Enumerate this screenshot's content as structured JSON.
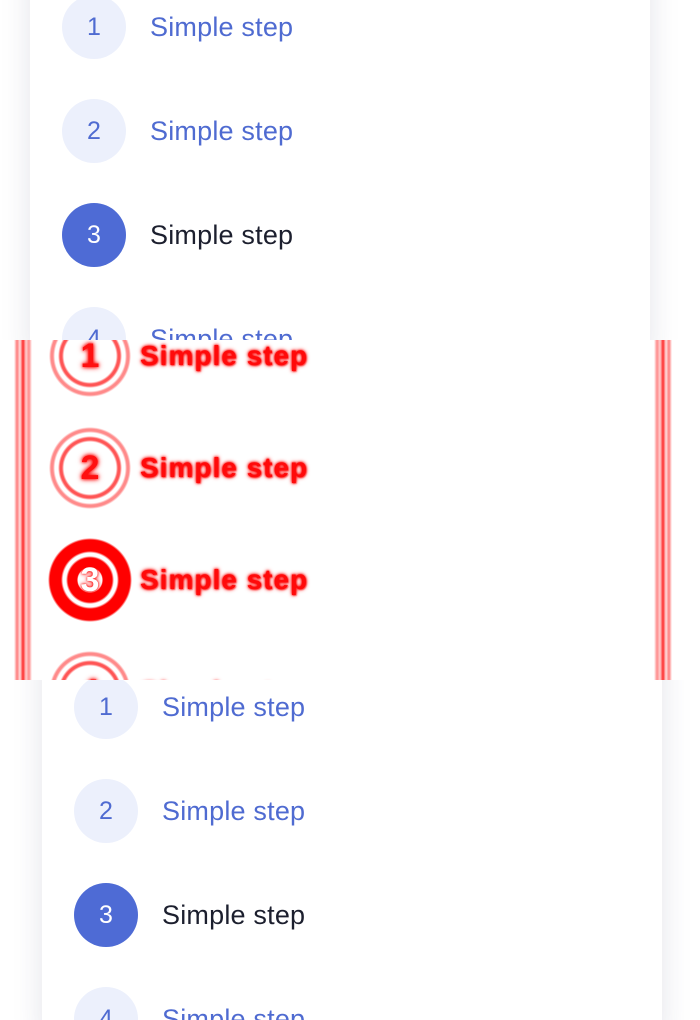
{
  "steps": [
    {
      "number": "1",
      "label": "Simple step",
      "state": "upcoming"
    },
    {
      "number": "2",
      "label": "Simple step",
      "state": "upcoming"
    },
    {
      "number": "3",
      "label": "Simple step",
      "state": "active"
    },
    {
      "number": "4",
      "label": "Simple step",
      "state": "upcoming"
    }
  ],
  "colors": {
    "accent": "#4e6bd5",
    "inactive_circle_bg": "#ecf0fc",
    "inactive_text": "#4f6bd1",
    "active_text": "#1c1f2e",
    "glitch_red": "#ff1010"
  }
}
